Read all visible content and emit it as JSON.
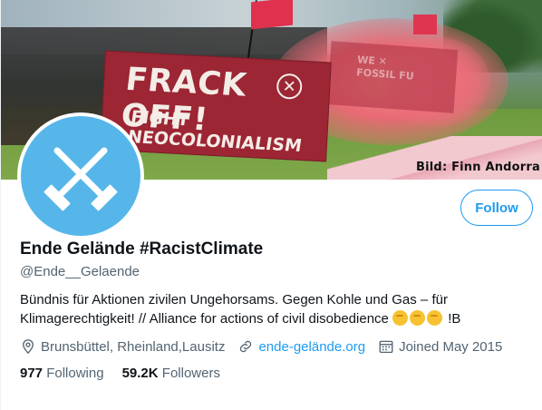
{
  "banner": {
    "photo_credit": "Bild: Finn Andorra",
    "banner_text_main": "FRACK OFF!",
    "banner_text_sub": "FIGHT NEOCOLONIALISM"
  },
  "profile": {
    "display_name": "Ende Gelände #RacistClimate",
    "handle": "@Ende__Gelaende",
    "bio_text": "Bündnis für Aktionen zivilen Ungehorsams. Gegen Kohle und Gas – für Klimagerechtigkeit! // Alliance for actions of civil disobedience",
    "bio_suffix": "!B",
    "location": "Brunsbüttel, Rheinland,Lausitz",
    "website": "ende-gelände.org",
    "joined": "Joined May 2015",
    "avatar_icon": "crossed-hammers-icon",
    "avatar_color": "#56b6ea"
  },
  "actions": {
    "follow_label": "Follow"
  },
  "stats": {
    "following_count": "977",
    "following_label": "Following",
    "followers_count": "59.2K",
    "followers_label": "Followers"
  },
  "colors": {
    "accent": "#1d9bf0",
    "secondary_text": "#536471",
    "banner_red": "#9c2634"
  }
}
